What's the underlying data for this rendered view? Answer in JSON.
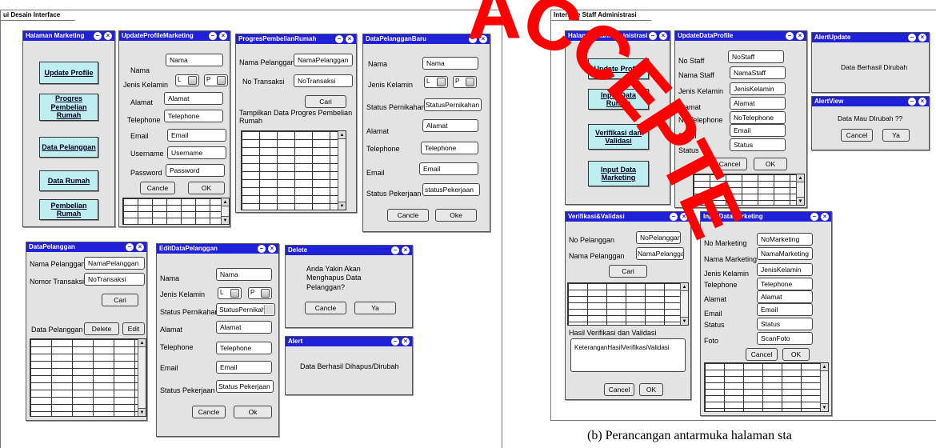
{
  "frames": {
    "left_title": "ui Desain Interface",
    "right_title": "Interface Staff Administrasi"
  },
  "caption": "(b)  Perancangan antarmuka halaman sta",
  "stamp_text": "ACCEPTED",
  "colors": {
    "titlebar": "#2020d8",
    "nav_button": "#bfeef0",
    "window": "#e3e3e3",
    "stamp": "#ff0000"
  },
  "halaman_marketing": {
    "title": "Halaman Marketing",
    "buttons": [
      "Update Profile",
      "Progres Pembelian Rumah",
      "Data Pelanggan",
      "Data Rumah",
      "Pembelian Rumah"
    ]
  },
  "update_profile_marketing": {
    "title": "UpdateProfileMarketing",
    "labels": {
      "nama": "Nama",
      "jk": "Jenis Kelamin",
      "alamat": "Alamat",
      "telephone": "Telephone",
      "email": "Email",
      "username": "Username",
      "password": "Password"
    },
    "fields": {
      "nama": "Nama",
      "alamat": "Alamat",
      "telephone": "Telephone",
      "email": "Email",
      "username": "Username",
      "password": "Password"
    },
    "radio_l": "L",
    "radio_p": "P",
    "cancel": "Cancle",
    "ok": "OK"
  },
  "progres_pembelian": {
    "title": "ProgresPembelianRumah",
    "labels": {
      "nama": "Nama Pelanggan",
      "no": "No Transaksi",
      "info": "Tampilkan Data Progres Pembelian Rumah"
    },
    "fields": {
      "nama": "NamaPelanggan",
      "no": "NoTransaksi"
    },
    "cari": "Cari"
  },
  "data_pelanggan_baru": {
    "title": "DataPelangganBaru",
    "labels": {
      "nama": "Nama",
      "jk": "Jenis Kelamin",
      "status_nikah": "Status Pernikahan",
      "alamat": "Alamat",
      "telephone": "Telephone",
      "email": "Email",
      "status_kerja": "Status Pekerjaan"
    },
    "fields": {
      "nama": "Nama",
      "status_nikah": "StatusPernikahan",
      "alamat": "Alamat",
      "telephone": "Telephone",
      "email": "Email",
      "status_kerja": "statusPekerjaan"
    },
    "radio_l": "L",
    "radio_p": "P",
    "cancel": "Cancle",
    "ok": "Oke"
  },
  "data_pelanggan": {
    "title": "DataPelanggan",
    "labels": {
      "nama": "Nama Pelanggan",
      "no": "Nomor Transaksi",
      "list": "Data Pelanggan"
    },
    "fields": {
      "nama": "NamaPelanggan",
      "no": "NoTransaksi"
    },
    "cari": "Cari",
    "delete": "Delete",
    "edit": "Edit"
  },
  "edit_data_pelanggan": {
    "title": "EditDataPelanggan",
    "labels": {
      "nama": "Nama",
      "jk": "Jenis Kelamin",
      "status_nikah": "Status Pernikahan",
      "alamat": "Alamat",
      "telephone": "Telephone",
      "email": "Email",
      "status_kerja": "Status Pekerjaan"
    },
    "fields": {
      "nama": "Nama",
      "status_nikah": "StatusPernikahan",
      "alamat": "Alamat",
      "telephone": "Telephone",
      "email": "Email",
      "status_kerja": "Status Pekerjaan"
    },
    "radio_l": "L",
    "radio_p": "P",
    "cancel": "Cancle",
    "ok": "Ok"
  },
  "delete_dialog": {
    "title": "Delete",
    "message": "Anda Yakin Akan Menghapus Data Pelanggan?",
    "cancel": "Cancle",
    "ok": "Ya"
  },
  "alert_dialog": {
    "title": "Alert",
    "message": "Data Berhasil Dihapus/Dirubah"
  },
  "halaman_staff": {
    "title": "HalamanStaffAdministrasi",
    "buttons": [
      "Update Profile",
      "Input Data Rumah",
      "Verifikasi dan Validasi",
      "Input Data Marketing"
    ]
  },
  "update_data_profile": {
    "title": "UpdateDataProfile",
    "labels": {
      "no_staff": "No Staff",
      "nama": "Nama Staff",
      "jk": "Jenis Kelamin",
      "alamat": "Alamat",
      "telephone": "No Telephone",
      "email": "Email",
      "status": "Status"
    },
    "fields": {
      "no_staff": "NoStaff",
      "nama": "NamaStaff",
      "jk": "JenisKelamin",
      "alamat": "Alamat",
      "telephone": "NoTelephone",
      "email": "Email",
      "status": "Status"
    },
    "cancel": "Cancel",
    "ok": "OK"
  },
  "alert_update": {
    "title": "AlertUpdate",
    "message": "Data Berhasil Dirubah"
  },
  "alert_view": {
    "title": "AlertView",
    "message": "Data Mau DIrubah ??",
    "cancel": "Cancel",
    "ok": "Ya"
  },
  "verifikasi": {
    "title": "Verifikasi&Validasi",
    "labels": {
      "no": "No Pelanggan",
      "nama": "Nama Pelanggan",
      "hasil": "Hasil Verifikasi dan Validasi"
    },
    "fields": {
      "no": "NoPelanggan",
      "nama": "NamaPelanggan",
      "hasil": "KeteranganHasilVerifikasiValidasi"
    },
    "cari": "Cari",
    "cancel": "Cancel",
    "ok": "OK"
  },
  "input_data_marketing": {
    "title": "InputDataMarketing",
    "labels": {
      "no": "No Marketing",
      "nama": "Nama Marketing",
      "jk": "Jenis Kelamin",
      "telephone": "Telephone",
      "alamat": "Alamat",
      "email": "Email",
      "status": "Status",
      "foto": "Foto"
    },
    "fields": {
      "no": "NoMarketing",
      "nama": "NamaMarketing",
      "jk": "JenisKelamin",
      "telephone": "Telephone",
      "alamat": "Alamat",
      "email": "Email",
      "status": "Status",
      "foto": "ScanFoto"
    },
    "cancel": "Cancel",
    "ok": "OK"
  }
}
